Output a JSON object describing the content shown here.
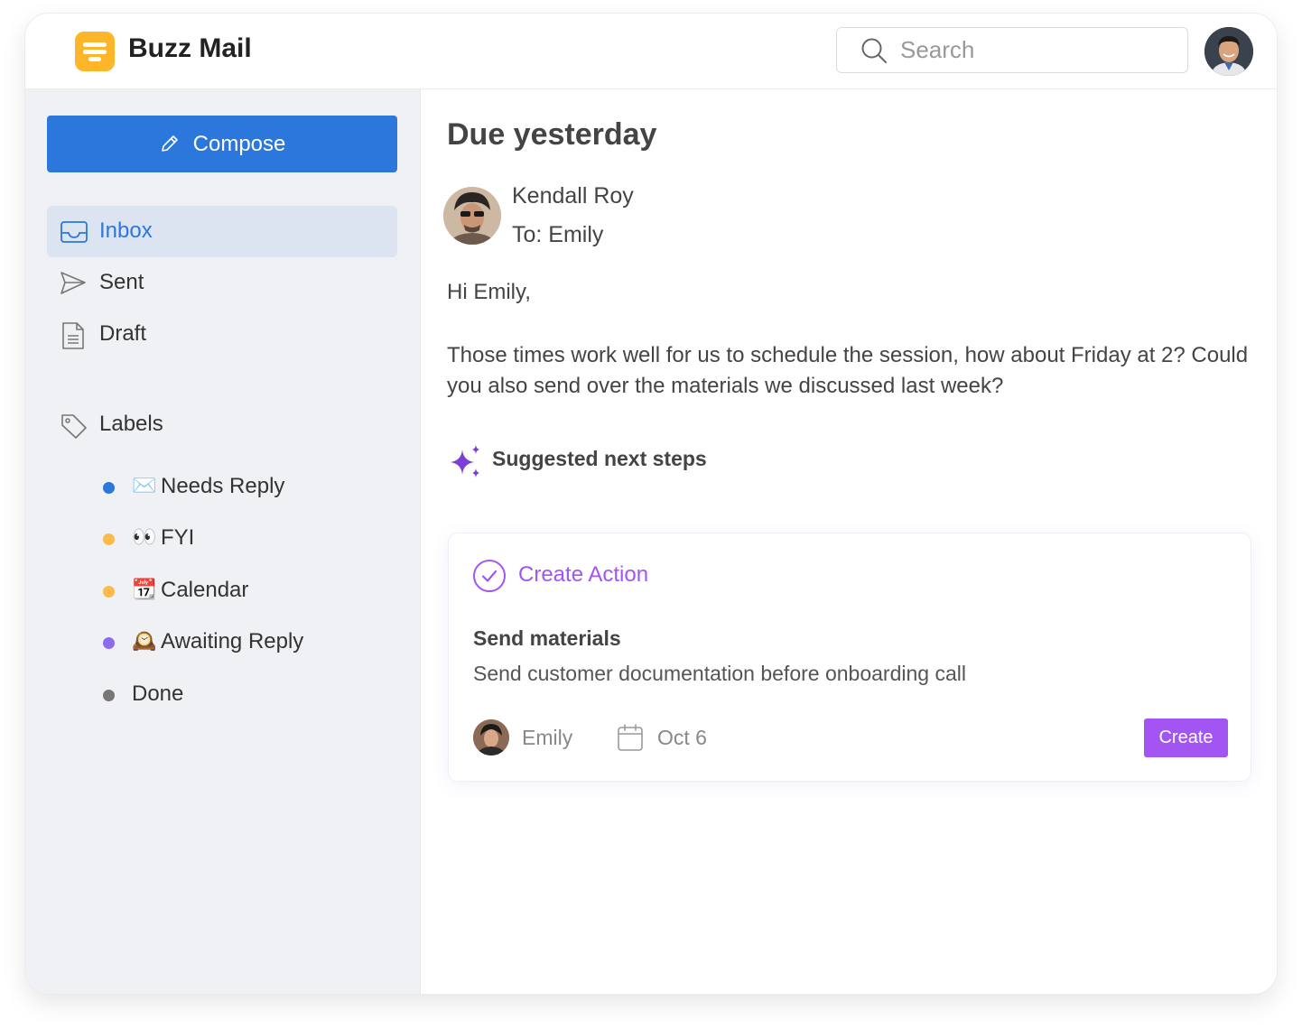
{
  "app": {
    "name": "Buzz Mail"
  },
  "header": {
    "search_placeholder": "Search"
  },
  "sidebar": {
    "compose_label": "Compose",
    "nav": [
      {
        "label": "Inbox",
        "icon": "inbox-icon",
        "active": true
      },
      {
        "label": "Sent",
        "icon": "send-icon",
        "active": false
      },
      {
        "label": "Draft",
        "icon": "draft-icon",
        "active": false
      }
    ],
    "labels_heading": "Labels",
    "labels": [
      {
        "emoji": "✉️",
        "label": "Needs Reply",
        "color": "#2B77DC"
      },
      {
        "emoji": "👀",
        "label": "FYI",
        "color": "#FDBA4A"
      },
      {
        "emoji": "📆",
        "label": "Calendar",
        "color": "#FDBA4A"
      },
      {
        "emoji": "🕰️",
        "label": "Awaiting Reply",
        "color": "#8B6CEF"
      },
      {
        "emoji": "",
        "label": "Done",
        "color": "#777777"
      }
    ]
  },
  "email": {
    "subject": "Due yesterday",
    "sender": "Kendall Roy",
    "recipient": "To: Emily",
    "greeting": "Hi Emily,",
    "body": "Those times work well for us to schedule the session, how about Friday at 2? Could you also send over the materials we discussed last week?"
  },
  "suggestions": {
    "heading": "Suggested next steps",
    "card": {
      "title": "Create Action",
      "task_title": "Send materials",
      "task_description": "Send customer documentation before onboarding call",
      "assignee": "Emily",
      "due_date": "Oct 6",
      "button_label": "Create"
    }
  },
  "colors": {
    "primary": "#2B77DC",
    "accent": "#A355F3",
    "logo": "#FDB52A",
    "sidebar_bg": "#F0F1F5",
    "active_nav_bg": "#DCE3F1"
  }
}
